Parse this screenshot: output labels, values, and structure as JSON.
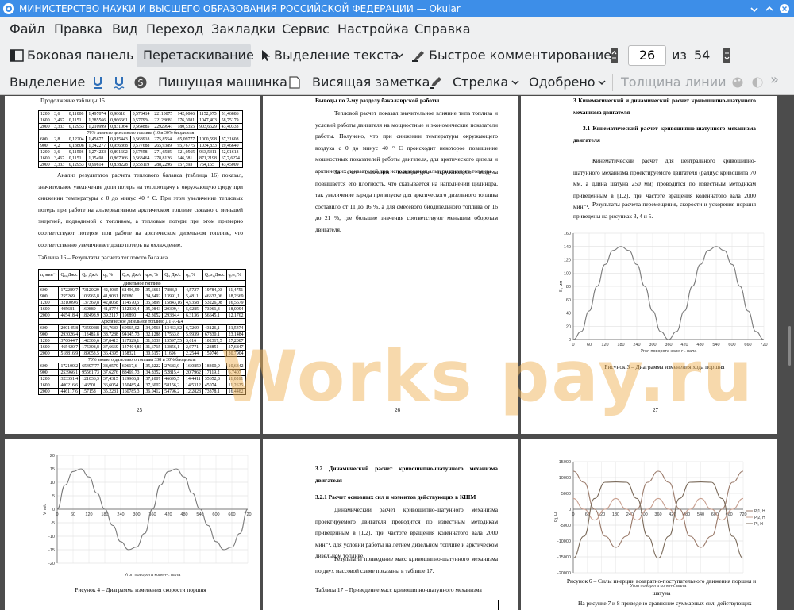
{
  "window": {
    "title": "МИНИСТЕРСТВО НАУКИ И ВЫСШЕГО ОБРАЗОВАНИЯ РОССИЙСКОЙ ФЕДЕРАЦИИ  — Okular"
  },
  "menu": [
    "Файл",
    "Правка",
    "Вид",
    "Переход",
    "Закладки",
    "Сервис",
    "Настройка",
    "Справка"
  ],
  "toolbar": {
    "sidebar": "Боковая панель",
    "drag": "Перетаскивание",
    "text_select": "Выделение текста",
    "quick_comment": "Быстрое комментирование",
    "page_current": "26",
    "page_of": "из",
    "page_total": "54"
  },
  "annot_toolbar": {
    "highlight": "Выделение",
    "typewriter": "Пишущая машинка",
    "note": "Висящая заметка",
    "arrow": "Стрелка",
    "stamp": "Одобрено",
    "line_width": "Толщина линии"
  },
  "watermark": "Works pay.ru",
  "page25": {
    "cont": "Продолжение таблицы 15",
    "table15": [
      [
        "1200",
        "3,6",
        "0,11808",
        "1,497074",
        "0,98618",
        "0,578414",
        "22110075",
        "142,0006",
        "1152,975",
        "51,46886"
      ],
      [
        "1600",
        "3,467",
        "0,1151",
        "1,385566",
        "0,866661",
        "0,5779%",
        "22128681",
        "176,3081",
        "1047,403",
        "58,75179"
      ],
      [
        "2000",
        "3,333",
        "0,12953",
        "1,210999",
        "0,831064",
        "0,564885",
        "22929941",
        "180,5355",
        "903,6629",
        "43,40333"
      ],
      [
        "span",
        "70% зимнего дизельного топлива (10 и 30% биодизеля"
      ],
      [
        "600",
        "2,8",
        "0,12204",
        "1,45677",
        "0,915443",
        "0,568918",
        "275,8554",
        "65,09777",
        "1000,598",
        "37,31608"
      ],
      [
        "900",
        "4,2",
        "0,13808",
        "1,342277",
        "0,956368",
        "0,577688",
        "265,9389",
        "95,76775",
        "1034,833",
        "29,46640"
      ],
      [
        "1200",
        "3,6",
        "0,11508",
        "1,274223",
        "0,891602",
        "0,57458",
        "271,6585",
        "121,0565",
        "963,5311",
        "52,91613"
      ],
      [
        "1600",
        "3,467",
        "0,1151",
        "1,15498",
        "0,867066",
        "0,563464",
        "278,8126",
        "146,381",
        "871,2198",
        "67,7,6274"
      ],
      [
        "2000",
        "3,333",
        "0,12953",
        "0,99814",
        "0,838228",
        "0,553119",
        "288,2296",
        "157,593",
        "754,155",
        "43,45009"
      ]
    ],
    "para": "Анализ результатов расчета теплового баланса (таблица 16) показал, значительное увеличение доли потерь на теплоотдачу в окружающую среду при снижении температуры с 0 до минус 40 ° С. При этом увеличение тепловых потерь при работе на альтернативном арктическом топливе связано с меньшей энергией, подводимой с топливом, а тепловые потери при этом примерно соответствуют потерям при работе на арктическом дизельном топливе, что соответственно увеличивает долю потерь на охлаждение.",
    "t16_caption": "Таблица 16 – Результаты расчета теплового баланса",
    "t16_header": [
      "n, мин⁻¹",
      "Q₀, Дж/с",
      "Qₑ, Дж/с",
      "qₑ, %",
      "Qₒₕₗ, Дж/с",
      "qₒₕₗ, %",
      "Qᵣ, Дж/с",
      "qᵣ, %",
      "Qₒₛₜ, Дж/с",
      "qₒₛₜ, %"
    ],
    "t16_rows": [
      [
        "span",
        "Дизельное топливо"
      ],
      [
        "600",
        "172289,7",
        "73120,29",
        "42,4085",
        "61496,59",
        "35,6661",
        "7883,9",
        "4,5727",
        "19784,03",
        "11,4751"
      ],
      [
        "900",
        "255269",
        "106965,8",
        "41,9031",
        "87680",
        "34,3492",
        "13991,1",
        "5,4811",
        "46632,06",
        "18,2669"
      ],
      [
        "1200",
        "321009,6",
        "137369,8",
        "42,8068",
        "114570,5",
        "35,6899",
        "15843,16",
        "4,9358",
        "53226,08",
        "16,5679"
      ],
      [
        "1600",
        "405681",
        "169889",
        "41,8774",
        "142330,4",
        "35,0843",
        "20399,4",
        "5,0285",
        "73061,3",
        "18,0094"
      ],
      [
        "2000",
        "465418,4",
        "182498,9",
        "39,2117",
        "196890",
        "42,3052",
        "29384,4",
        "6,3136",
        "56645,1",
        "12,1702"
      ],
      [
        "span",
        "Арктическое дизельное топливо ДТ-А-К4"
      ],
      [
        "600",
        "200145,8",
        "73590,88",
        "36,7683",
        "69965,02",
        "34,9568",
        "13463,82",
        "6,7269",
        "43126,1",
        "21,5474"
      ],
      [
        "900",
        "293026,4",
        "113485,8",
        "38,7288",
        "94145,73",
        "32,1288",
        "17563,8",
        "5,9939",
        "67830,1",
        "23,1484"
      ],
      [
        "1200",
        "376044,7",
        "142300,6",
        "37,8413",
        "117829,1",
        "31,3339",
        "13597,55",
        "3,616",
        "102317,5",
        "27,2087"
      ],
      [
        "1600",
        "465420,7",
        "175308,8",
        "37,6669",
        "147404,81",
        "31,6715",
        "13856,1",
        "2,9771",
        "128851",
        "27,6847"
      ],
      [
        "2000",
        "518816,9",
        "189053,5",
        "36,4395",
        "158321",
        "30,5157",
        "11696",
        "2,2544",
        "159746",
        "30,7904"
      ],
      [
        "span",
        "70% зимнего дизельного топлива 338 и 30% биодизеля"
      ],
      [
        "600",
        "172100,2",
        "65497,77",
        "38,0579",
        "60617,6",
        "35,2222",
        "27683,9",
        "16,0859",
        "18300,9",
        "10,6342"
      ],
      [
        "900",
        "253966,1",
        "95561,73",
        "37,6276",
        "88469,73",
        "34,8352",
        "52815,4",
        "20,7962",
        "17119,2",
        "6,7407"
      ],
      [
        "1200",
        "323351,4",
        "121036,3",
        "37,4315",
        "119966,8",
        "37,1007",
        "46695,5",
        "14,4411",
        "35652,8",
        "11,0261"
      ],
      [
        "1600",
        "400216,6",
        "146501",
        "36,6054",
        "150485,4",
        "37,6007",
        "58156,2",
        "14,5312",
        "45074",
        "11,2625"
      ],
      [
        "2000",
        "446117,6",
        "157158",
        "35,2281",
        "160785,3",
        "36,0412",
        "54796,2",
        "12,2828",
        "73378,1",
        "16,4482"
      ]
    ],
    "num": "25"
  },
  "page26": {
    "heading": "Выводы по 2-му разделу бакалаврской работы",
    "para1": "Тепловой расчет показал значительное влияние типа топлива и условий работы двигателя на мощностные и экономические показатели работы. Получено, что при снижении температуры окружающего воздуха с 0 до минус 40 ° С происходит некоторое повышение мощностных показателей работы двигателя, для арктического дизеля и арктических показателей при использовании альтернативного топлива.",
    "para2": "За счет снижения температуры окружающего воздуха повышается его плотность, что сказывается на наполнении цилиндра, так увеличение заряда при впуске для арктического дизельного топлива составило от 11 до 16 %, а для смесевого биодизельного топлива от 16 до 21 %, где большие значения соответствуют меньшим оборотам двигателя.",
    "num": "26"
  },
  "page27": {
    "heading1": "3 Кинематический и динамический расчет кривошипно-шатунного механизма двигателя",
    "heading2": "3.1 Кинематический расчет кривошипно-шатунного механизма двигателя",
    "para1": "Кинематический расчет для центрального кривошипно-шатунного механизма проектируемого двигателя (радиус кривошипа 70 мм, а длина шатуна 250 мм) проводится по известным методикам приведенным в [1,2], при частоте вращения коленчатого вала 2000 мин⁻¹.",
    "para2": "Результаты расчета перемещения, скорости и ускорения поршня приведены на рисунках 3, 4 и 5.",
    "caption": "Рисунок 3 – Диаграмма изменения хода поршня",
    "num": "27"
  },
  "page28": {
    "caption": "Рисунок 4 – Диаграмма изменения скорости поршня"
  },
  "page29": {
    "heading1": "3.2 Динамический расчет кривошипно-шатунного механизма двигателя",
    "heading2": "3.2.1 Расчет основных сил и моментов действующих в КШМ",
    "para1": "Динамический расчет кривошипно-шатунного механизма проектируемого двигателя проводится по известным методикам приведенным в [1,2], при частоте вращения коленчатого вала 2000 мин⁻¹, для условий работы на летнем дизельном топливе и арктическом дизельном топливе.",
    "para2": "Результаты приведение масс кривошипно-шатунного механизма по двух массовой схеме показаны в таблице 17.",
    "t17_caption": "Таблица 17 – Приведение масс кривошипно-шатунного механизма"
  },
  "page30": {
    "caption": "Рисунок 6 – Силы инерции возвратно-поступательного движения поршня и шатуна",
    "tail": "На рисунке 7 и 8 приведено сравнение суммарных сил, действующих"
  },
  "chart_data": [
    {
      "type": "line",
      "xlabel": "Угол поворота коленч. вала",
      "ylabel": "S, мм",
      "xlim": [
        0,
        720
      ],
      "ylim": [
        0,
        160
      ],
      "xticks": [
        0,
        60,
        120,
        180,
        240,
        300,
        360,
        420,
        480,
        540,
        600,
        660,
        720
      ],
      "yticks": [
        0,
        20,
        40,
        60,
        80,
        100,
        120,
        140,
        160
      ],
      "series": [
        {
          "x": [
            0,
            30,
            60,
            90,
            120,
            150,
            180,
            210,
            240,
            270,
            300,
            330,
            360,
            390,
            420,
            450,
            480,
            510,
            540,
            570,
            600,
            630,
            660,
            690,
            720
          ],
          "y": [
            0,
            12,
            43,
            80,
            113,
            134,
            140,
            134,
            113,
            80,
            43,
            12,
            0,
            12,
            43,
            80,
            113,
            134,
            140,
            134,
            113,
            80,
            43,
            12,
            0
          ]
        }
      ]
    },
    {
      "type": "line",
      "xlabel": "Угол поворота коленч. вала",
      "ylabel": "V, м/с",
      "xlim": [
        0,
        720
      ],
      "ylim": [
        -20,
        20
      ],
      "xticks": [
        0,
        60,
        120,
        180,
        240,
        300,
        360,
        420,
        480,
        540,
        600,
        660,
        720
      ],
      "yticks": [
        -20,
        -15,
        -10,
        -5,
        0,
        5,
        10,
        15,
        20
      ],
      "series": [
        {
          "x": [
            0,
            30,
            60,
            90,
            120,
            150,
            180,
            210,
            240,
            270,
            300,
            330,
            360,
            390,
            420,
            450,
            480,
            510,
            540,
            570,
            600,
            630,
            660,
            690,
            720
          ],
          "y": [
            0,
            9,
            14,
            15,
            12,
            6,
            0,
            -6,
            -12,
            -15,
            -14,
            -9,
            0,
            9,
            14,
            15,
            12,
            6,
            0,
            -6,
            -12,
            -15,
            -14,
            -9,
            0
          ]
        }
      ]
    },
    {
      "type": "line",
      "xlabel": "Угол поворота коленч. вала",
      "ylabel": "Pj, H",
      "xlim": [
        0,
        720
      ],
      "ylim": [
        -20000,
        15000
      ],
      "xticks": [
        0,
        60,
        120,
        180,
        240,
        300,
        360,
        420,
        480,
        540,
        600,
        660,
        720
      ],
      "yticks": [
        -20000,
        -15000,
        -10000,
        -5000,
        0,
        5000,
        10000,
        15000
      ],
      "legend": [
        "Pj1, H",
        "Pj2, H",
        "Pj, H"
      ],
      "series": [
        {
          "name": "Pj1, H",
          "x": [
            0,
            45,
            90,
            135,
            180,
            225,
            270,
            315,
            360,
            405,
            450,
            495,
            540,
            585,
            630,
            675,
            720
          ],
          "y": [
            12000,
            8500,
            0,
            -8500,
            -12000,
            -8500,
            0,
            8500,
            12000,
            8500,
            0,
            -8500,
            -12000,
            -8500,
            0,
            8500,
            12000
          ]
        },
        {
          "name": "Pj2, H",
          "x": [
            0,
            45,
            90,
            135,
            180,
            225,
            270,
            315,
            360,
            405,
            450,
            495,
            540,
            585,
            630,
            675,
            720
          ],
          "y": [
            3400,
            0,
            -3400,
            0,
            3400,
            0,
            -3400,
            0,
            3400,
            0,
            -3400,
            0,
            3400,
            0,
            -3400,
            0,
            3400
          ]
        },
        {
          "name": "Pj, H",
          "x": [
            0,
            45,
            90,
            135,
            180,
            225,
            270,
            315,
            360,
            405,
            450,
            495,
            540,
            585,
            630,
            675,
            720
          ],
          "y": [
            -15400,
            -8500,
            3400,
            8500,
            8600,
            8500,
            3400,
            -8500,
            -15400,
            -8500,
            3400,
            8500,
            8600,
            8500,
            3400,
            -8500,
            -15400
          ]
        }
      ]
    }
  ]
}
